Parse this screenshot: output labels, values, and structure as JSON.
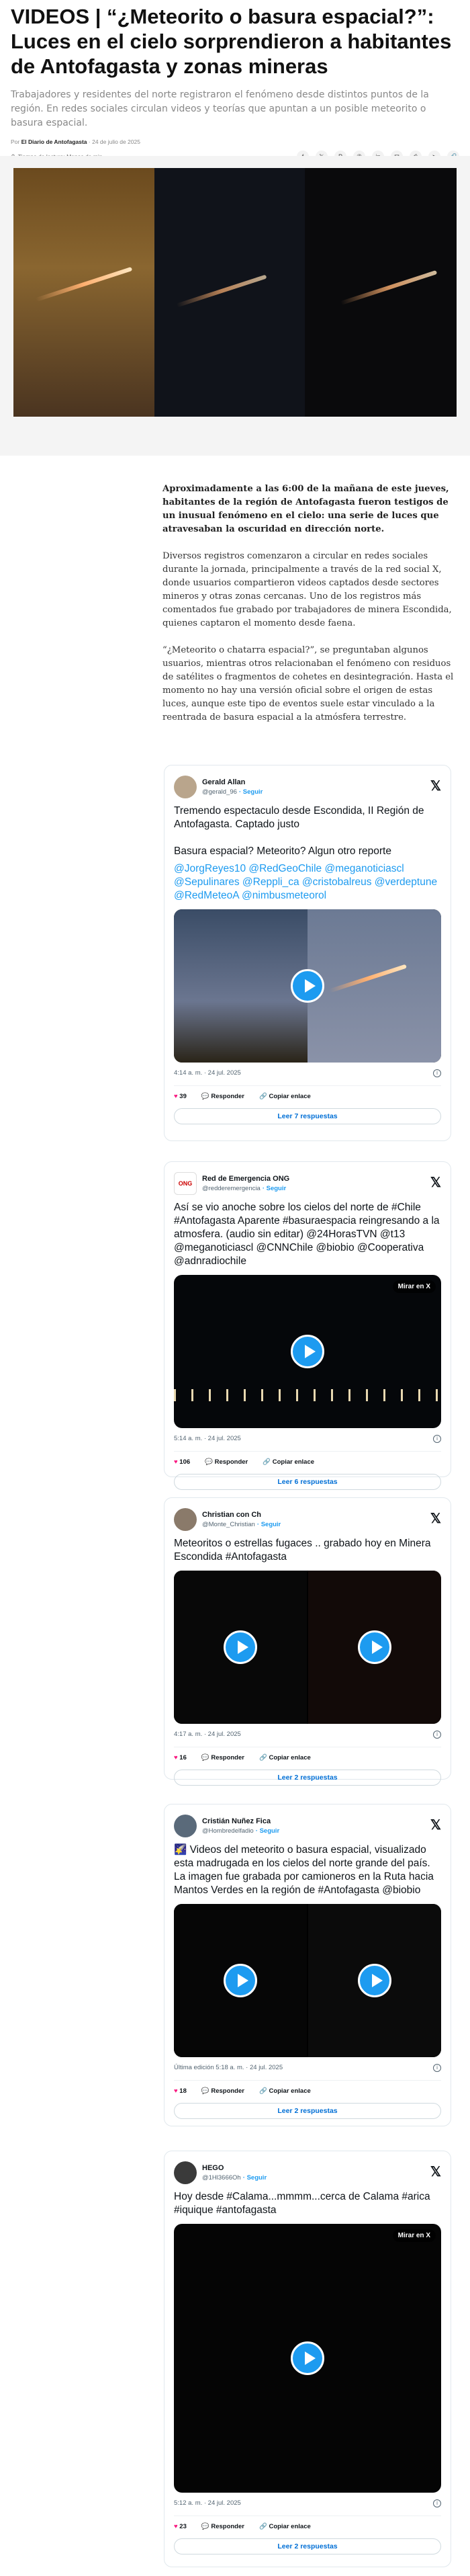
{
  "article": {
    "title": "VIDEOS | “¿Meteorito o basura espacial?”: Luces en el cielo sorprendieron a habitantes de Antofagasta y zonas mineras",
    "subtitle": "Trabajadores y residentes del norte registraron el fenómeno desde distintos puntos de la región. En redes sociales circulan videos y teorías que apuntan a un posible meteorito o basura espacial.",
    "by_prefix": "Por",
    "author": "El Diario de Antofagasta",
    "date": "· 24 de julio de 2025",
    "read_time": "Tiempo de lectura: Menos de min",
    "share_icons": [
      "facebook-icon",
      "x-icon",
      "pinterest-icon",
      "whatsapp-icon",
      "linkedin-icon",
      "email-icon",
      "print-icon",
      "telegram-icon",
      "link-icon"
    ],
    "paragraphs": [
      "Aproximadamente a las 6:00 de la mañana de este jueves, habitantes de la región de Antofagasta fueron testigos de un inusual fenómeno en el cielo: una serie de luces que atravesaban la oscuridad en dirección norte.",
      "Diversos registros comenzaron a circular en redes sociales durante la jornada, principalmente a través de la red social X, donde usuarios compartieron videos captados desde sectores mineros y otras zonas cercanas. Uno de los registros más comentados fue grabado por trabajadores de minera Escondida, quienes captaron el momento desde faena.",
      "“¿Meteorito o chatarra espacial?”, se preguntaban algunos usuarios, mientras otros relacionaban el fenómeno con residuos de satélites o fragmentos de cohetes en desintegración. Hasta el momento no hay una versión oficial sobre el origen de estas luces, aunque este tipo de eventos suele estar vinculado a la reentrada de basura espacial a la atmósfera terrestre."
    ]
  },
  "tweets": [
    {
      "name": "Gerald Allan",
      "handle": "@gerald_96",
      "follow": "· Seguir",
      "text": "Tremendo espectaculo desde Escondida, II Región de Antofagasta. Captado justo\n\nBasura espacial? Meteorito? Algun otro reporte",
      "tags": "@JorgReyes10 @RedGeoChile @meganoticiascl @Sepulinares @Reppli_ca @cristobalreus @verdeptune @RedMeteoA @nimbusmeteorol",
      "time": "4:14 a. m. · 24 jul. 2025",
      "likes": "39",
      "reply": "Responder",
      "copy": "Copiar enlace",
      "more": "Leer 7 respuestas",
      "mirar": ""
    },
    {
      "name": "Red de Emergencia ONG",
      "handle": "@redderemergencia",
      "follow": "· Seguir",
      "text": "Así se vio anoche sobre los cielos del norte de #Chile #Antofagasta  Aparente #basuraespacia reingresando a la atmosfera. (audio sin editar) @24HorasTVN @t13 @meganoticiascl @CNNChile @biobio @Cooperativa @adnradiochile",
      "tags": "",
      "time": "5:14 a. m. · 24 jul. 2025",
      "likes": "106",
      "reply": "Responder",
      "copy": "Copiar enlace",
      "more": "Leer 6 respuestas",
      "mirar": "Mirar en X"
    },
    {
      "name": "Christian con Ch",
      "handle": "@Monte_Christian",
      "follow": "· Seguir",
      "text": "Meteoritos o estrellas fugaces .. grabado hoy en Minera Escondida #Antofagasta",
      "tags": "",
      "time": "4:17 a. m. · 24 jul. 2025",
      "likes": "16",
      "reply": "Responder",
      "copy": "Copiar enlace",
      "more": "Leer 2 respuestas",
      "mirar": ""
    },
    {
      "name": "Cristián Nuñez Fica",
      "handle": "@Hombredelfadio",
      "follow": "· Seguir",
      "text": "🌠 Videos del meteorito o basura espacial, visualizado esta madrugada en los cielos del norte grande del país. La imagen fue grabada por camioneros en la Ruta hacia Mantos Verdes en la región de #Antofagasta @biobio",
      "tags": "",
      "time": "Última edición 5:18 a. m. · 24 jul. 2025",
      "likes": "18",
      "reply": "Responder",
      "copy": "Copiar enlace",
      "more": "Leer 2 respuestas",
      "mirar": ""
    },
    {
      "name": "HEGO",
      "handle": "@1Hl3666Oh",
      "follow": "· Seguir",
      "text": "Hoy desde #Calama...mmmm...cerca de Calama #arica #iquique #antofagasta",
      "tags": "",
      "time": "5:12 a. m. · 24 jul. 2025",
      "likes": "23",
      "reply": "Responder",
      "copy": "Copiar enlace",
      "more": "Leer 2 respuestas",
      "mirar": "Mirar en X"
    }
  ]
}
